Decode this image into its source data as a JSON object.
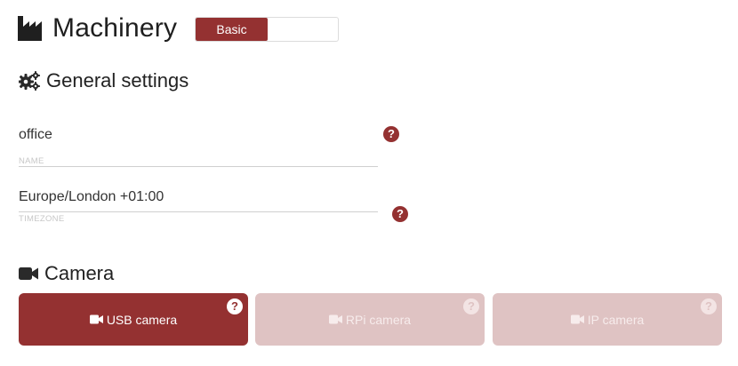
{
  "header": {
    "title": "Machinery",
    "icon": "factory-icon",
    "mode_toggle": {
      "selected": "Basic",
      "options_visible": [
        "Basic"
      ]
    }
  },
  "general": {
    "heading": "General settings",
    "icon": "cogs-icon",
    "name_field": {
      "value": "office",
      "label": "NAME",
      "help_icon": "question-circle-icon"
    },
    "timezone_field": {
      "value": "Europe/London +01:00",
      "label": "TIMEZONE",
      "help_icon": "question-circle-icon"
    }
  },
  "camera": {
    "heading": "Camera",
    "icon": "video-camera-icon",
    "options": [
      {
        "label": "USB camera",
        "active": true
      },
      {
        "label": "RPi camera",
        "active": false
      },
      {
        "label": "IP camera",
        "active": false
      }
    ],
    "help_glyph": "?"
  },
  "colors": {
    "accent": "#943131",
    "inactive_card": "#dfc3c3",
    "field_line": "#cfcfcf",
    "field_label": "#c7c7c7"
  }
}
